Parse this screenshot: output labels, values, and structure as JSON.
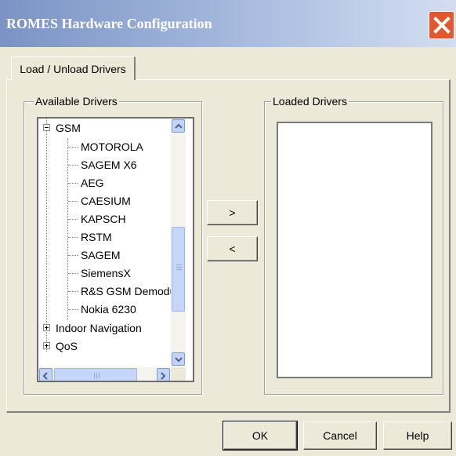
{
  "window": {
    "title": "ROMES Hardware Configuration"
  },
  "tabs": [
    {
      "label": "Load / Unload Drivers",
      "selected": true
    }
  ],
  "available_drivers": {
    "label": "Available Drivers",
    "tree": {
      "expanded_node": "GSM",
      "children": [
        "MOTOROLA",
        "SAGEM X6",
        "AEG",
        "CAESIUM",
        "KAPSCH",
        "RSTM",
        "SAGEM",
        "SiemensX",
        "R&S GSM Demodu",
        "Nokia 6230"
      ],
      "collapsed_nodes": [
        "Indoor Navigation",
        "QoS"
      ]
    }
  },
  "loaded_drivers": {
    "label": "Loaded Drivers",
    "items": []
  },
  "transfer": {
    "add_label": ">",
    "remove_label": "<"
  },
  "footer": {
    "ok_label": "OK",
    "cancel_label": "Cancel",
    "help_label": "Help"
  },
  "icons": {
    "close": "close-icon",
    "scroll_up": "chevron-up-icon",
    "scroll_down": "chevron-down-icon",
    "scroll_left": "chevron-left-icon",
    "scroll_right": "chevron-right-icon",
    "expand": "plus-icon",
    "collapse": "minus-icon"
  },
  "colors": {
    "titlebar_start": "#7a93c4",
    "titlebar_end": "#d3ddf0",
    "close_button": "#e1582f",
    "dialog_bg": "#ece9d8",
    "scroll_button": "#c1d3fb"
  }
}
